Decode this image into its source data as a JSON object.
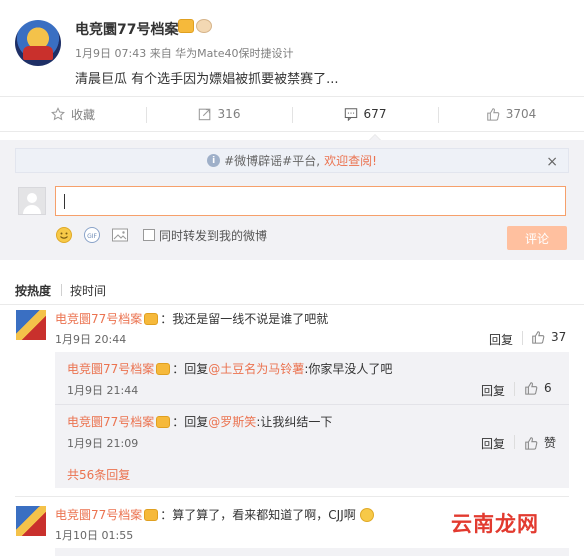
{
  "post": {
    "username": "电竞圜77号档案",
    "meta": "1月9日 07:43 来自 华为Mate40保时捷设计",
    "text": "清晨巨瓜 有个选手因为嫖娼被抓要被禁赛了..."
  },
  "actions": {
    "favorite": "收藏",
    "repost_count": "316",
    "comment_count": "677",
    "like_count": "3704"
  },
  "comment_box": {
    "notice_prefix": "#微博辟谣#平台,",
    "notice_link": "欢迎查阅!",
    "notice_close": "×",
    "forward_label": "同时转发到我的微博",
    "submit_label": "评论"
  },
  "sort": {
    "hot": "按热度",
    "time": "按时间"
  },
  "comments": [
    {
      "name": "电竞圜77号档案",
      "text": "：我还是留一线不说是谁了吧就",
      "time": "1月9日 20:44",
      "reply": "回复",
      "likes": "37",
      "replies": [
        {
          "name": "电竞圜77号档案",
          "reply_word": "：回复",
          "mention": "@土豆名为马铃薯",
          "text": ":你家早没人了吧",
          "time": "1月9日 21:44",
          "reply": "回复",
          "likes": "6"
        },
        {
          "name": "电竞圜77号档案",
          "reply_word": "：回复",
          "mention": "@罗斯笑",
          "text": ":让我纠结一下",
          "time": "1月9日 21:09",
          "reply": "回复",
          "likes": "赞"
        }
      ],
      "more": "共56条回复"
    },
    {
      "name": "电竞圜77号档案",
      "text": "：算了算了，看来都知道了啊，CJJ啊",
      "time": "1月10日 01:55"
    }
  ],
  "watermark": "云南龙网",
  "colors": {
    "accent": "#eb7350",
    "submit_disabled": "#ffc09f",
    "panel_bg": "#f2f2f5"
  },
  "icons": [
    "star-icon",
    "repost-icon",
    "comment-icon",
    "thumb-up-icon",
    "smile-icon",
    "gif-icon",
    "image-icon",
    "info-icon"
  ]
}
